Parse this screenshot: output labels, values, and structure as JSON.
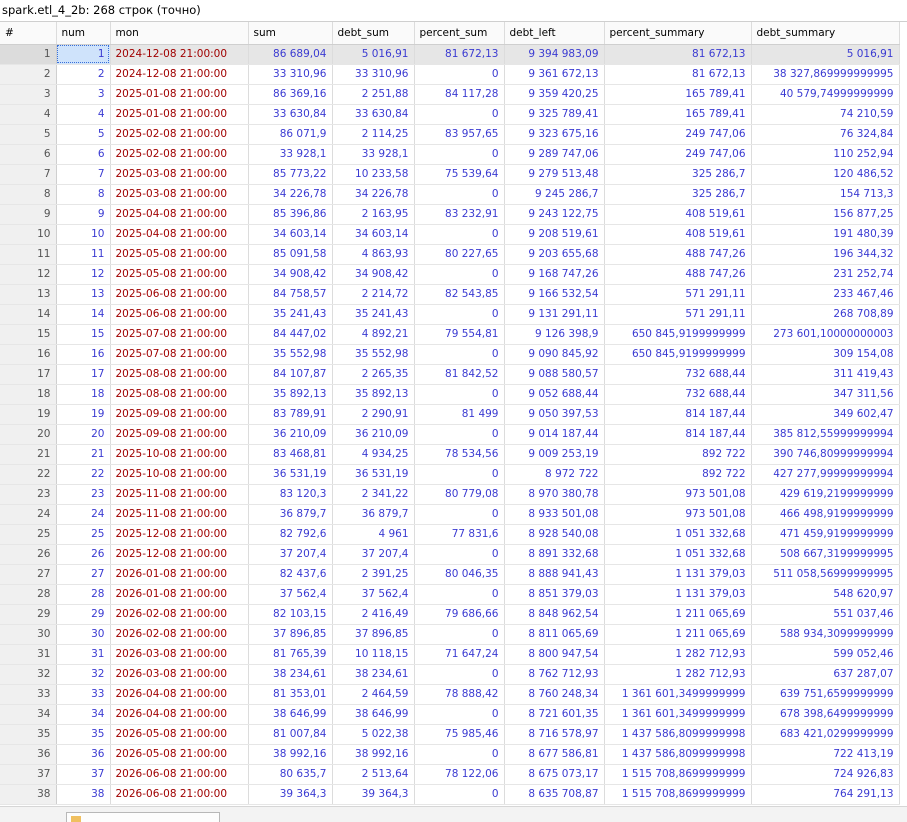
{
  "window": {
    "title": "spark.etl_4_2b: 268 строк (точно)"
  },
  "table": {
    "columns": [
      "#",
      "num",
      "mon",
      "sum",
      "debt_sum",
      "percent_sum",
      "debt_left",
      "percent_summary",
      "debt_summary"
    ],
    "rows": [
      [
        "1",
        "1",
        "2024-12-08 21:00:00",
        "86 689,04",
        "5 016,91",
        "81 672,13",
        "9 394 983,09",
        "81 672,13",
        "5 016,91"
      ],
      [
        "2",
        "2",
        "2024-12-08 21:00:00",
        "33 310,96",
        "33 310,96",
        "0",
        "9 361 672,13",
        "81 672,13",
        "38 327,869999999995"
      ],
      [
        "3",
        "3",
        "2025-01-08 21:00:00",
        "86 369,16",
        "2 251,88",
        "84 117,28",
        "9 359 420,25",
        "165 789,41",
        "40 579,74999999999"
      ],
      [
        "4",
        "4",
        "2025-01-08 21:00:00",
        "33 630,84",
        "33 630,84",
        "0",
        "9 325 789,41",
        "165 789,41",
        "74 210,59"
      ],
      [
        "5",
        "5",
        "2025-02-08 21:00:00",
        "86 071,9",
        "2 114,25",
        "83 957,65",
        "9 323 675,16",
        "249 747,06",
        "76 324,84"
      ],
      [
        "6",
        "6",
        "2025-02-08 21:00:00",
        "33 928,1",
        "33 928,1",
        "0",
        "9 289 747,06",
        "249 747,06",
        "110 252,94"
      ],
      [
        "7",
        "7",
        "2025-03-08 21:00:00",
        "85 773,22",
        "10 233,58",
        "75 539,64",
        "9 279 513,48",
        "325 286,7",
        "120 486,52"
      ],
      [
        "8",
        "8",
        "2025-03-08 21:00:00",
        "34 226,78",
        "34 226,78",
        "0",
        "9 245 286,7",
        "325 286,7",
        "154 713,3"
      ],
      [
        "9",
        "9",
        "2025-04-08 21:00:00",
        "85 396,86",
        "2 163,95",
        "83 232,91",
        "9 243 122,75",
        "408 519,61",
        "156 877,25"
      ],
      [
        "10",
        "10",
        "2025-04-08 21:00:00",
        "34 603,14",
        "34 603,14",
        "0",
        "9 208 519,61",
        "408 519,61",
        "191 480,39"
      ],
      [
        "11",
        "11",
        "2025-05-08 21:00:00",
        "85 091,58",
        "4 863,93",
        "80 227,65",
        "9 203 655,68",
        "488 747,26",
        "196 344,32"
      ],
      [
        "12",
        "12",
        "2025-05-08 21:00:00",
        "34 908,42",
        "34 908,42",
        "0",
        "9 168 747,26",
        "488 747,26",
        "231 252,74"
      ],
      [
        "13",
        "13",
        "2025-06-08 21:00:00",
        "84 758,57",
        "2 214,72",
        "82 543,85",
        "9 166 532,54",
        "571 291,11",
        "233 467,46"
      ],
      [
        "14",
        "14",
        "2025-06-08 21:00:00",
        "35 241,43",
        "35 241,43",
        "0",
        "9 131 291,11",
        "571 291,11",
        "268 708,89"
      ],
      [
        "15",
        "15",
        "2025-07-08 21:00:00",
        "84 447,02",
        "4 892,21",
        "79 554,81",
        "9 126 398,9",
        "650 845,9199999999",
        "273 601,10000000003"
      ],
      [
        "16",
        "16",
        "2025-07-08 21:00:00",
        "35 552,98",
        "35 552,98",
        "0",
        "9 090 845,92",
        "650 845,9199999999",
        "309 154,08"
      ],
      [
        "17",
        "17",
        "2025-08-08 21:00:00",
        "84 107,87",
        "2 265,35",
        "81 842,52",
        "9 088 580,57",
        "732 688,44",
        "311 419,43"
      ],
      [
        "18",
        "18",
        "2025-08-08 21:00:00",
        "35 892,13",
        "35 892,13",
        "0",
        "9 052 688,44",
        "732 688,44",
        "347 311,56"
      ],
      [
        "19",
        "19",
        "2025-09-08 21:00:00",
        "83 789,91",
        "2 290,91",
        "81 499",
        "9 050 397,53",
        "814 187,44",
        "349 602,47"
      ],
      [
        "20",
        "20",
        "2025-09-08 21:00:00",
        "36 210,09",
        "36 210,09",
        "0",
        "9 014 187,44",
        "814 187,44",
        "385 812,55999999994"
      ],
      [
        "21",
        "21",
        "2025-10-08 21:00:00",
        "83 468,81",
        "4 934,25",
        "78 534,56",
        "9 009 253,19",
        "892 722",
        "390 746,80999999994"
      ],
      [
        "22",
        "22",
        "2025-10-08 21:00:00",
        "36 531,19",
        "36 531,19",
        "0",
        "8 972 722",
        "892 722",
        "427 277,99999999994"
      ],
      [
        "23",
        "23",
        "2025-11-08 21:00:00",
        "83 120,3",
        "2 341,22",
        "80 779,08",
        "8 970 380,78",
        "973 501,08",
        "429 619,2199999999"
      ],
      [
        "24",
        "24",
        "2025-11-08 21:00:00",
        "36 879,7",
        "36 879,7",
        "0",
        "8 933 501,08",
        "973 501,08",
        "466 498,9199999999"
      ],
      [
        "25",
        "25",
        "2025-12-08 21:00:00",
        "82 792,6",
        "4 961",
        "77 831,6",
        "8 928 540,08",
        "1 051 332,68",
        "471 459,9199999999"
      ],
      [
        "26",
        "26",
        "2025-12-08 21:00:00",
        "37 207,4",
        "37 207,4",
        "0",
        "8 891 332,68",
        "1 051 332,68",
        "508 667,3199999995"
      ],
      [
        "27",
        "27",
        "2026-01-08 21:00:00",
        "82 437,6",
        "2 391,25",
        "80 046,35",
        "8 888 941,43",
        "1 131 379,03",
        "511 058,56999999995"
      ],
      [
        "28",
        "28",
        "2026-01-08 21:00:00",
        "37 562,4",
        "37 562,4",
        "0",
        "8 851 379,03",
        "1 131 379,03",
        "548 620,97"
      ],
      [
        "29",
        "29",
        "2026-02-08 21:00:00",
        "82 103,15",
        "2 416,49",
        "79 686,66",
        "8 848 962,54",
        "1 211 065,69",
        "551 037,46"
      ],
      [
        "30",
        "30",
        "2026-02-08 21:00:00",
        "37 896,85",
        "37 896,85",
        "0",
        "8 811 065,69",
        "1 211 065,69",
        "588 934,3099999999"
      ],
      [
        "31",
        "31",
        "2026-03-08 21:00:00",
        "81 765,39",
        "10 118,15",
        "71 647,24",
        "8 800 947,54",
        "1 282 712,93",
        "599 052,46"
      ],
      [
        "32",
        "32",
        "2026-03-08 21:00:00",
        "38 234,61",
        "38 234,61",
        "0",
        "8 762 712,93",
        "1 282 712,93",
        "637 287,07"
      ],
      [
        "33",
        "33",
        "2026-04-08 21:00:00",
        "81 353,01",
        "2 464,59",
        "78 888,42",
        "8 760 248,34",
        "1 361 601,3499999999",
        "639 751,6599999999"
      ],
      [
        "34",
        "34",
        "2026-04-08 21:00:00",
        "38 646,99",
        "38 646,99",
        "0",
        "8 721 601,35",
        "1 361 601,3499999999",
        "678 398,6499999999"
      ],
      [
        "35",
        "35",
        "2026-05-08 21:00:00",
        "81 007,84",
        "5 022,38",
        "75 985,46",
        "8 716 578,97",
        "1 437 586,8099999998",
        "683 421,0299999999"
      ],
      [
        "36",
        "36",
        "2026-05-08 21:00:00",
        "38 992,16",
        "38 992,16",
        "0",
        "8 677 586,81",
        "1 437 586,8099999998",
        "722 413,19"
      ],
      [
        "37",
        "37",
        "2026-06-08 21:00:00",
        "80 635,7",
        "2 513,64",
        "78 122,06",
        "8 675 073,17",
        "1 515 708,8699999999",
        "724 926,83"
      ],
      [
        "38",
        "38",
        "2026-06-08 21:00:00",
        "39 364,3",
        "39 364,3",
        "0",
        "8 635 708,87",
        "1 515 708,8699999999",
        "764 291,13"
      ]
    ]
  }
}
